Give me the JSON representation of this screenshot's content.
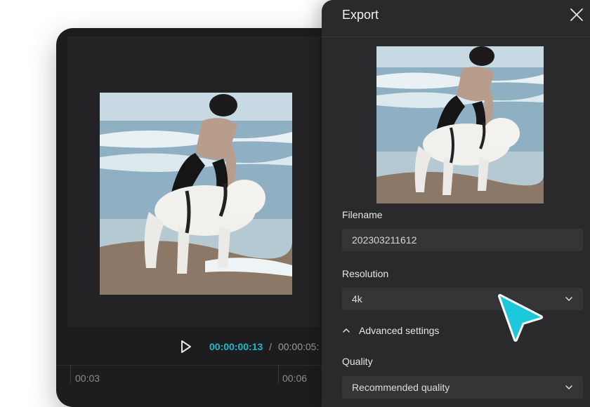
{
  "player": {
    "current_time": "00:00:00:13",
    "separator": "/",
    "total_time": "00:00:05:",
    "ruler_labels": [
      "00:03",
      "00:06"
    ]
  },
  "export_dialog": {
    "title": "Export",
    "filename_label": "Filename",
    "filename_value": "202303211612",
    "resolution_label": "Resolution",
    "resolution_value": "4k",
    "advanced_label": "Advanced settings",
    "quality_label": "Quality",
    "quality_value": "Recommended quality"
  },
  "colors": {
    "accent": "#20b7c7",
    "cursor": "#1ec8dc"
  },
  "icons": [
    "play-icon",
    "close-icon",
    "chevron-down-icon",
    "chevron-up-icon",
    "pointer-cursor-icon"
  ]
}
